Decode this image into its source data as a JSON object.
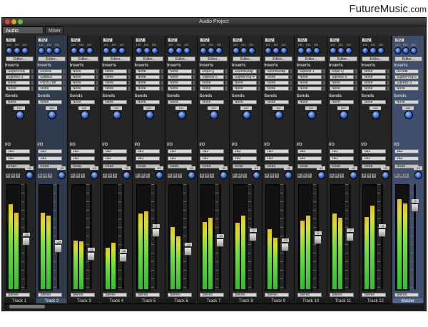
{
  "branding": {
    "logo": "FutureMusic",
    "domain": ".com"
  },
  "window": {
    "title": "Audio Project"
  },
  "tabs": [
    {
      "label": "Audio Document",
      "active": true
    },
    {
      "label": "Mixer",
      "active": false
    }
  ],
  "common": {
    "eq": "EQ",
    "editor": "Editor...",
    "inserts": "Inserts",
    "sends": "Sends",
    "io": "I/O",
    "read": "Read",
    "stereo": "Stereo",
    "input": "1&2",
    "output": "1&2",
    "send_slot": "None",
    "send_level": "152",
    "knob_values": [
      "152",
      "152",
      "152"
    ],
    "r": "R",
    "m": "M",
    "s": "S"
  },
  "strips": [
    {
      "name": "Track 1",
      "inserts": [
        "SuperFreq",
        "Sqeeez-3",
        "None",
        "None"
      ],
      "fader_db": "-10",
      "pan": "-43",
      "meters": [
        0.82,
        0.74
      ],
      "fader_pos": 0.55
    },
    {
      "name": "Track 2",
      "inserts": [
        "Reveal",
        "GateEx",
        "PitchCraft",
        "None"
      ],
      "fader_db": "-13",
      "pan": "-43",
      "meters": [
        0.74,
        0.71
      ],
      "fader_pos": 0.62,
      "selected": true
    },
    {
      "name": "Track 3",
      "inserts": [
        "None",
        "None",
        "None",
        "None"
      ],
      "fader_db": "-11",
      "pan": "-43",
      "meters": [
        0.47,
        0.46
      ],
      "fader_pos": 0.7
    },
    {
      "name": "Track 4",
      "inserts": [
        "None",
        "None",
        "None",
        "None"
      ],
      "fader_db": "-16",
      "pan": "-43",
      "meters": [
        0.4,
        0.45
      ],
      "fader_pos": 0.72
    },
    {
      "name": "Track 5",
      "inserts": [
        "None",
        "None",
        "None",
        "None"
      ],
      "fader_db": "-1",
      "pan": "-43",
      "meters": [
        0.73,
        0.75
      ],
      "fader_pos": 0.46
    },
    {
      "name": "Track 6",
      "inserts": [
        "None",
        "None",
        "None",
        "None"
      ],
      "fader_db": "-13",
      "pan": "-43",
      "meters": [
        0.6,
        0.51
      ],
      "fader_pos": 0.65
    },
    {
      "name": "Track 7",
      "inserts": [
        "Repli-Q",
        "Sqeeez-5",
        "None",
        "None"
      ],
      "fader_db": "-10",
      "pan": "-43",
      "meters": [
        0.65,
        0.69
      ],
      "fader_pos": 0.56
    },
    {
      "name": "Track 8",
      "inserts": [
        "SoundSoap",
        "SuperFreq-4",
        "None",
        "None"
      ],
      "fader_db": "-2",
      "pan": "-43",
      "meters": [
        0.64,
        0.71
      ],
      "fader_pos": 0.5
    },
    {
      "name": "Track 9",
      "inserts": [
        "SoundSoap",
        "None",
        "None",
        "None"
      ],
      "fader_db": "-12",
      "pan": "-43",
      "meters": [
        0.58,
        0.5
      ],
      "fader_pos": 0.61
    },
    {
      "name": "Track 10",
      "inserts": [
        "Sqeeez-1",
        "None",
        "None",
        "None"
      ],
      "fader_db": "-8",
      "pan": "-43",
      "meters": [
        0.66,
        0.71
      ],
      "fader_pos": 0.53
    },
    {
      "name": "Track 11",
      "inserts": [
        "Repli-Q",
        "Sqeeez-5",
        "None",
        "None"
      ],
      "fader_db": "-7",
      "pan": "-43",
      "meters": [
        0.73,
        0.69
      ],
      "fader_pos": 0.5
    },
    {
      "name": "Track 12",
      "inserts": [
        "None",
        "None",
        "None",
        "None"
      ],
      "fader_db": "-4",
      "pan": "-43",
      "meters": [
        0.7,
        0.81
      ],
      "fader_pos": 0.46
    },
    {
      "name": "Master",
      "inserts": [
        "Reveal",
        "SuperFreq-6",
        "Sqeeez-3",
        "None"
      ],
      "fader_db": "-2",
      "pan": "-43",
      "meters": [
        0.87,
        0.83
      ],
      "fader_pos": 0.2,
      "master": true
    }
  ]
}
